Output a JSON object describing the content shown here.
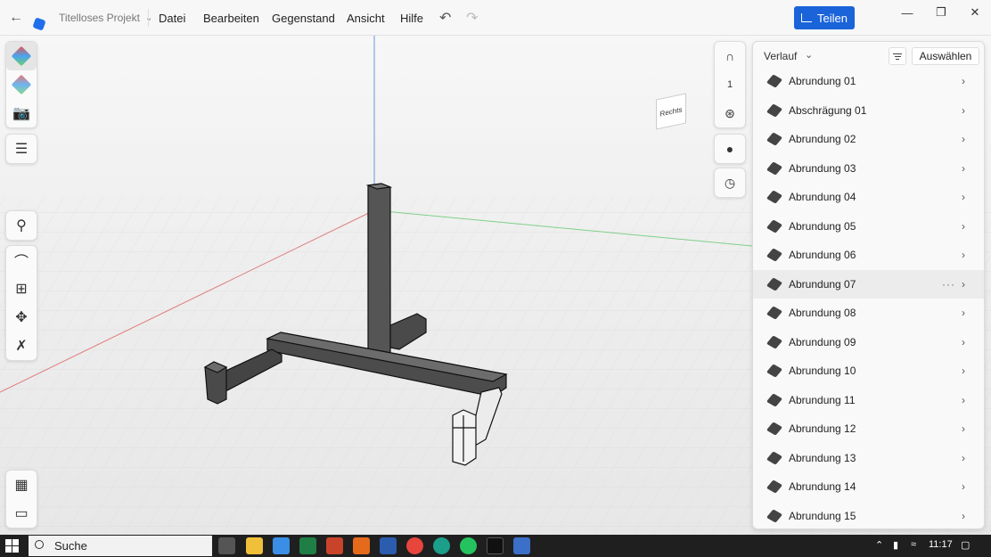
{
  "titlebar": {
    "project_title": "Titelloses Projekt",
    "menu": [
      "Datei",
      "Bearbeiten",
      "Gegenstand",
      "Ansicht",
      "Hilfe"
    ],
    "share_label": "Teilen",
    "accent": "#1a63d9"
  },
  "viewport": {
    "viewcube_label": "Rechts",
    "magnet_value": "1"
  },
  "history_panel": {
    "title": "Verlauf",
    "select_label": "Auswählen",
    "hover_index": 7,
    "items": [
      "Abrundung 01",
      "Abschrägung 01",
      "Abrundung 02",
      "Abrundung 03",
      "Abrundung 04",
      "Abrundung 05",
      "Abrundung 06",
      "Abrundung 07",
      "Abrundung 08",
      "Abrundung 09",
      "Abrundung 10",
      "Abrundung 11",
      "Abrundung 12",
      "Abrundung 13",
      "Abrundung 14",
      "Abrundung 15"
    ],
    "more_label": "···"
  },
  "taskbar": {
    "search_label": "Suche",
    "time": "11:17"
  }
}
